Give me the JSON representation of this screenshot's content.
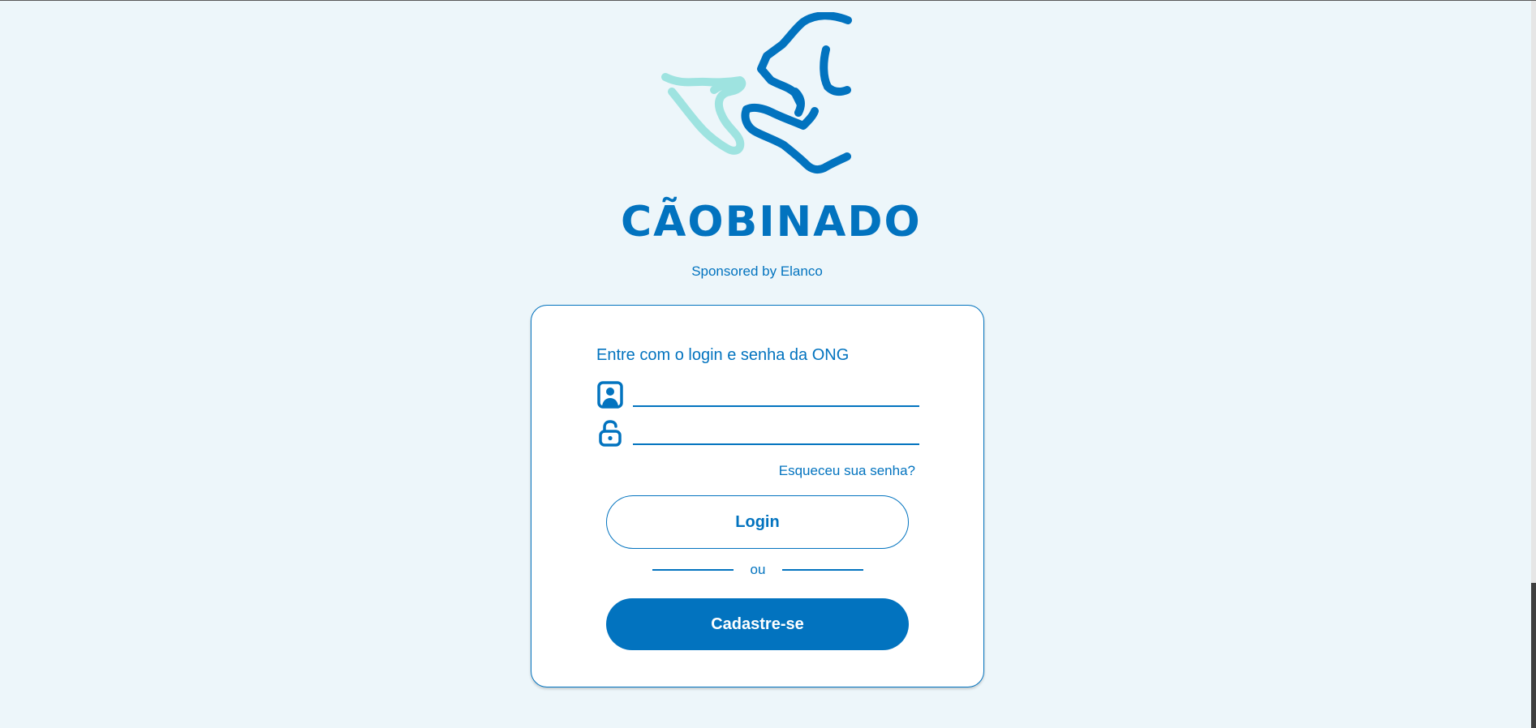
{
  "brand": {
    "name": "CÃOBINADO",
    "sponsor": "Sponsored by Elanco"
  },
  "login_card": {
    "title": "Entre com o login e senha da ONG",
    "username_field": {
      "value": "",
      "placeholder": "",
      "icon": "user-badge-icon"
    },
    "password_field": {
      "value": "",
      "placeholder": "",
      "icon": "lock-icon"
    },
    "forgot_password": "Esqueceu sua senha?",
    "login_button": "Login",
    "divider_text": "ou",
    "register_button": "Cadastre-se"
  },
  "colors": {
    "background": "#edf6fa",
    "primary": "#0273bf",
    "accent_light": "#9ee3e0",
    "card": "#ffffff"
  }
}
